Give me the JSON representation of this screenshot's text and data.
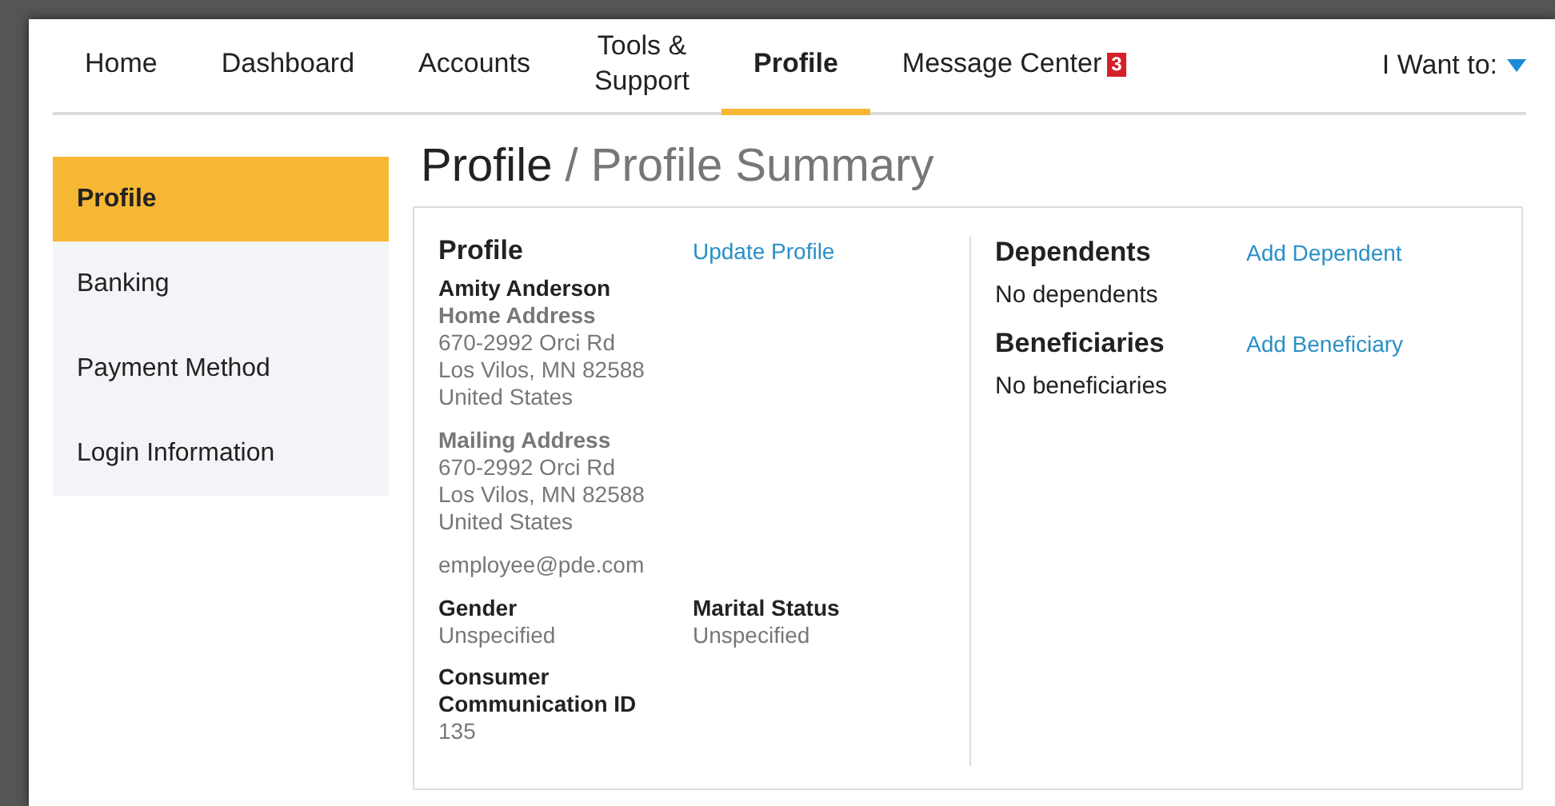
{
  "nav": {
    "items": [
      {
        "label": "Home",
        "selected": false
      },
      {
        "label": "Dashboard",
        "selected": false
      },
      {
        "label": "Accounts",
        "selected": false
      },
      {
        "label": "Tools &\nSupport",
        "selected": false
      },
      {
        "label": "Profile",
        "selected": true
      },
      {
        "label": "Message Center",
        "selected": false,
        "badge": "3"
      }
    ],
    "menu": {
      "label": "I Want to:"
    }
  },
  "sidebar": {
    "items": [
      {
        "label": "Profile",
        "selected": true
      },
      {
        "label": "Banking",
        "selected": false
      },
      {
        "label": "Payment Method",
        "selected": false
      },
      {
        "label": "Login Information",
        "selected": false
      }
    ]
  },
  "page_title": {
    "section": "Profile",
    "separator": "/ Profile Summary"
  },
  "profile": {
    "heading": "Profile",
    "link": "Update Profile",
    "name": "Amity Anderson",
    "addresses": [
      {
        "label": "Home Address",
        "lines": [
          "670-2992 Orci Rd",
          "Los Vilos, MN 82588",
          "United States"
        ]
      },
      {
        "label": "Mailing Address",
        "lines": [
          "670-2992 Orci Rd",
          "Los Vilos, MN 82588",
          "United States"
        ]
      }
    ],
    "email": "employee@pde.com",
    "fields": [
      {
        "label": "Gender",
        "value": "Unspecified"
      },
      {
        "label": "Marital Status",
        "value": "Unspecified"
      }
    ],
    "communication": {
      "label": "Consumer\nCommunication ID",
      "value": "135"
    }
  },
  "sections": [
    {
      "heading": "Dependents",
      "link": "Add Dependent",
      "empty": "No dependents"
    },
    {
      "heading": "Beneficiaries",
      "link": "Add Beneficiary",
      "empty": "No beneficiaries"
    }
  ]
}
